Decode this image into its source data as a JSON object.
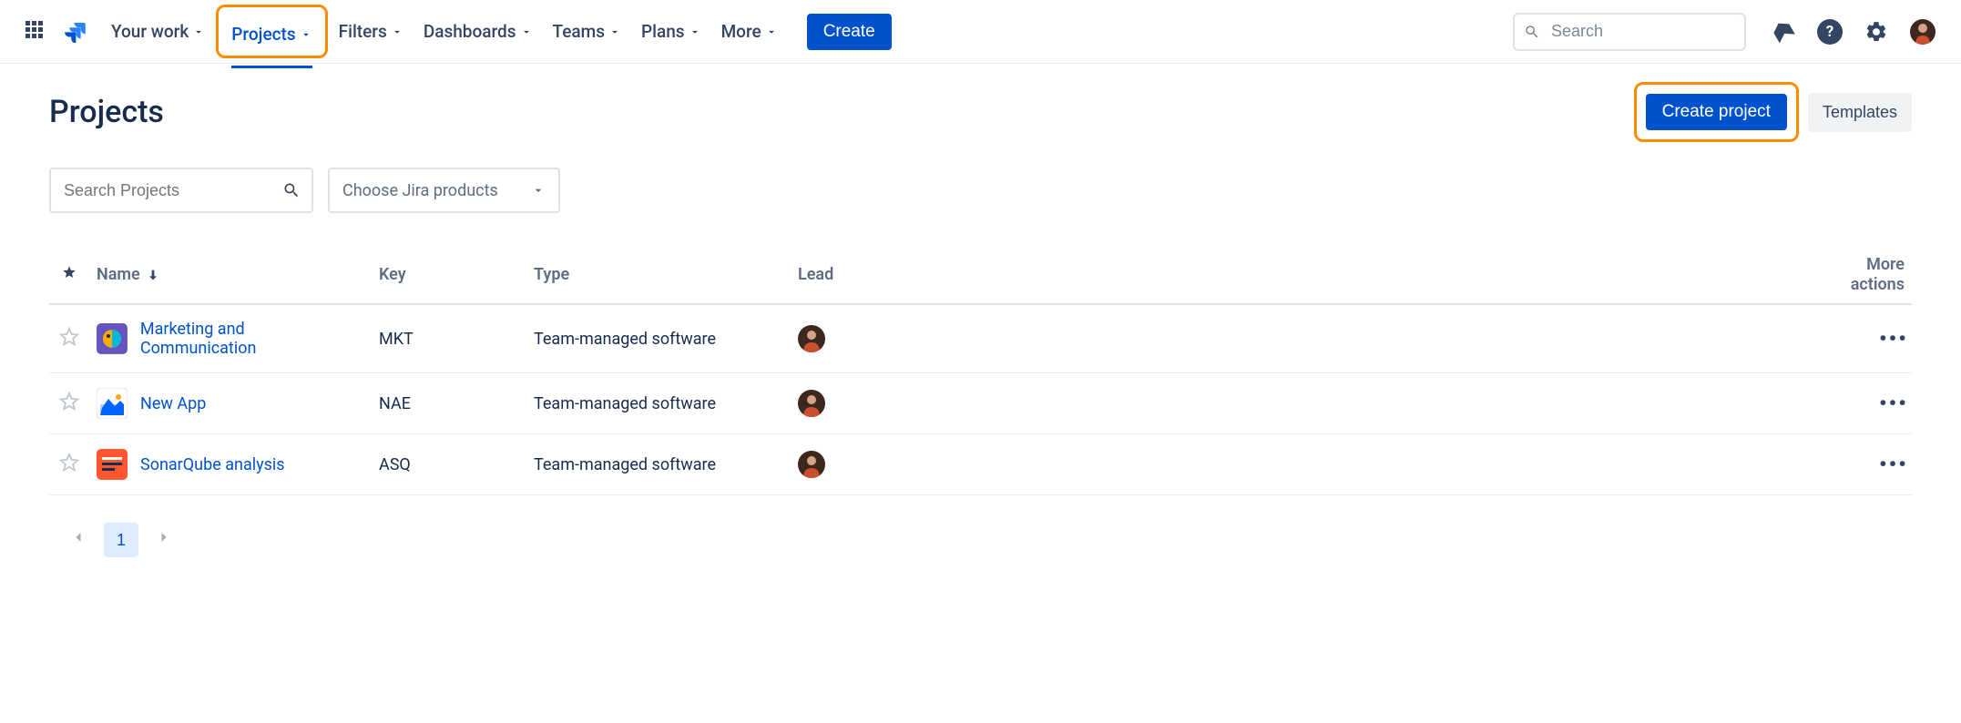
{
  "nav": {
    "items": [
      {
        "label": "Your work"
      },
      {
        "label": "Projects",
        "active": true
      },
      {
        "label": "Filters"
      },
      {
        "label": "Dashboards"
      },
      {
        "label": "Teams"
      },
      {
        "label": "Plans"
      },
      {
        "label": "More"
      }
    ],
    "create_label": "Create",
    "search_placeholder": "Search"
  },
  "page": {
    "title": "Projects",
    "create_project_label": "Create project",
    "templates_label": "Templates",
    "search_placeholder": "Search Projects",
    "product_select_label": "Choose Jira products"
  },
  "table": {
    "headers": {
      "name": "Name",
      "key": "Key",
      "type": "Type",
      "lead": "Lead",
      "more": "More actions"
    },
    "rows": [
      {
        "name": "Marketing and Communication",
        "key": "MKT",
        "type": "Team-managed software",
        "icon_bg": "#6554C0"
      },
      {
        "name": "New App",
        "key": "NAE",
        "type": "Team-managed software",
        "icon_bg": "#ffffff"
      },
      {
        "name": "SonarQube analysis",
        "key": "ASQ",
        "type": "Team-managed software",
        "icon_bg": "#FF5630"
      }
    ]
  },
  "pagination": {
    "current": "1"
  }
}
